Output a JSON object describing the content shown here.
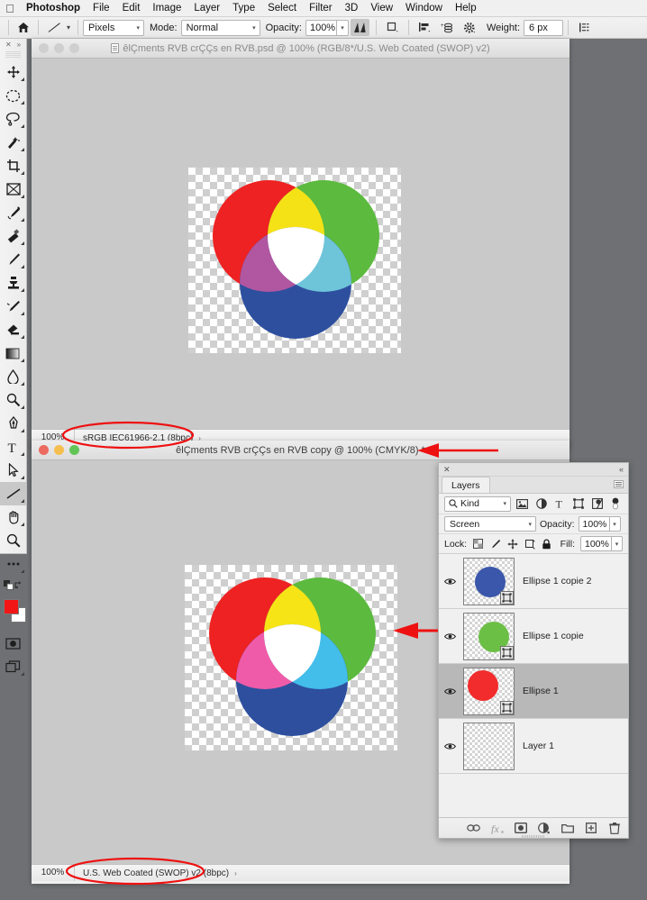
{
  "menubar": {
    "apple": "apple-logo",
    "items": [
      "Photoshop",
      "File",
      "Edit",
      "Image",
      "Layer",
      "Type",
      "Select",
      "Filter",
      "3D",
      "View",
      "Window",
      "Help"
    ]
  },
  "options_bar": {
    "home_icon": "home-icon",
    "tool_preset": "line-tool-preview",
    "shape_mode": "Pixels",
    "mode_label": "Mode:",
    "blend_mode": "Normal",
    "opacity_label": "Opacity:",
    "opacity_value": "100%",
    "antialias_icon": "antialias-icon",
    "rect_icon": "geometry-options-icon",
    "align_icon": "align-edges-icon",
    "stack_icon": "add-to-stack-icon",
    "gear_icon": "settings-gear-icon",
    "weight_label": "Weight:",
    "weight_value": "6 px",
    "arrange_icon": "arrange-documents-icon"
  },
  "toolbar": {
    "collapse_icon": "collapse-panel-icon",
    "expand_icon": "expand-panel-icon",
    "tools": [
      {
        "name": "move-tool",
        "selected": false
      },
      {
        "name": "elliptical-marquee-tool",
        "selected": false
      },
      {
        "name": "lasso-tool",
        "selected": false
      },
      {
        "name": "quick-selection-tool",
        "selected": false
      },
      {
        "name": "crop-tool",
        "selected": false
      },
      {
        "name": "frame-tool",
        "selected": false
      },
      {
        "name": "eyedropper-tool",
        "selected": false
      },
      {
        "name": "spot-healing-brush-tool",
        "selected": false
      },
      {
        "name": "brush-tool",
        "selected": false
      },
      {
        "name": "clone-stamp-tool",
        "selected": false
      },
      {
        "name": "history-brush-tool",
        "selected": false
      },
      {
        "name": "eraser-tool",
        "selected": false
      },
      {
        "name": "gradient-tool",
        "selected": false
      },
      {
        "name": "blur-tool",
        "selected": false
      },
      {
        "name": "dodge-tool",
        "selected": false
      },
      {
        "name": "pen-tool",
        "selected": false
      },
      {
        "name": "type-tool",
        "selected": false
      },
      {
        "name": "path-selection-tool",
        "selected": false
      },
      {
        "name": "line-shape-tool",
        "selected": true
      },
      {
        "name": "hand-tool",
        "selected": false
      },
      {
        "name": "zoom-tool",
        "selected": false
      },
      {
        "name": "edit-toolbar-tool",
        "selected": false
      }
    ],
    "swap_colors_icon": "swap-colors-icon",
    "default_colors_icon": "default-colors-icon",
    "foreground_color": "#f21616",
    "background_color": "#ffffff",
    "quick_mask_icon": "quick-mask-icon",
    "screen_mode_icon": "screen-mode-icon"
  },
  "window1": {
    "title": "êlÇments RVB crÇÇs en RVB.psd @ 100% (RGB/8*/U.S. Web Coated (SWOP) v2)",
    "active": false,
    "doc_icon": "document-icon",
    "traffic_lights": [
      "close-button",
      "minimize-button",
      "zoom-button"
    ],
    "status": {
      "zoom": "100%",
      "profile": "sRGB IEC61966-2.1 (8bpc)",
      "chevron": "›"
    }
  },
  "window2": {
    "title": "êlÇments RVB crÇÇs en RVB copy @ 100% (CMYK/8) *",
    "active": true,
    "traffic_lights": [
      "close-button",
      "minimize-button",
      "zoom-button"
    ],
    "status": {
      "zoom": "100%",
      "profile": "U.S. Web Coated (SWOP) v2 (8bpc)",
      "chevron": "›"
    }
  },
  "artwork_rgb": {
    "name": "rgb-venn-diagram",
    "red": "#ee2222",
    "green": "#5cba3f",
    "blue": "#2d4f9e",
    "yellow": "#f5e216",
    "magenta": "#b156a0",
    "cyan": "#6ec4d9",
    "white": "#ffffff"
  },
  "artwork_cmyk": {
    "name": "cmyk-venn-diagram",
    "red": "#ee2222",
    "green": "#5cba3f",
    "blue": "#2d4f9e",
    "yellow": "#f7e416",
    "magenta": "#ef5ba8",
    "cyan": "#43bdea",
    "white": "#ffffff"
  },
  "layers_panel": {
    "close_icon": "close-panel-icon",
    "collapse_icon": "collapse-to-icons-icon",
    "tab_label": "Layers",
    "menu_icon": "panel-menu-icon",
    "filter": {
      "search_icon": "search-icon",
      "kind_label": "Kind",
      "icons": [
        "pixel-filter-icon",
        "adjustment-filter-icon",
        "type-filter-icon",
        "shape-filter-icon",
        "smart-object-filter-icon",
        "filter-toggle-icon"
      ]
    },
    "blend_mode": "Screen",
    "opacity_label": "Opacity:",
    "opacity_value": "100%",
    "lock_label": "Lock:",
    "lock_icons": [
      "lock-transparent-pixels-icon",
      "lock-image-pixels-icon",
      "lock-position-icon",
      "lock-artboard-nesting-icon",
      "lock-all-icon"
    ],
    "fill_label": "Fill:",
    "fill_value": "100%",
    "layers": [
      {
        "name": "Ellipse 1 copie 2",
        "visible": true,
        "selected": false,
        "thumb_color": "#3a57ab",
        "has_vector_badge": true
      },
      {
        "name": "Ellipse 1 copie",
        "visible": true,
        "selected": false,
        "thumb_color": "#6cbf45",
        "has_vector_badge": true
      },
      {
        "name": "Ellipse 1",
        "visible": true,
        "selected": true,
        "thumb_color": "#f22c2c",
        "has_vector_badge": true
      },
      {
        "name": "Layer 1",
        "visible": true,
        "selected": false,
        "thumb_color": null,
        "has_vector_badge": false
      }
    ],
    "bottom_icons": [
      "link-layers-icon",
      "add-layer-style-icon",
      "add-layer-mask-icon",
      "new-adjustment-layer-icon",
      "new-group-icon",
      "new-layer-icon",
      "delete-layer-icon"
    ]
  },
  "annotations": {
    "color": "#ee1111",
    "ellipse_profile_rgb": "highlight-ellipse-rgb-profile",
    "ellipse_profile_cmyk": "highlight-ellipse-cmyk-profile",
    "arrow_title": "arrow-pointing-to-cmyk-title",
    "arrow_layer": "arrow-pointing-to-green-layer"
  }
}
